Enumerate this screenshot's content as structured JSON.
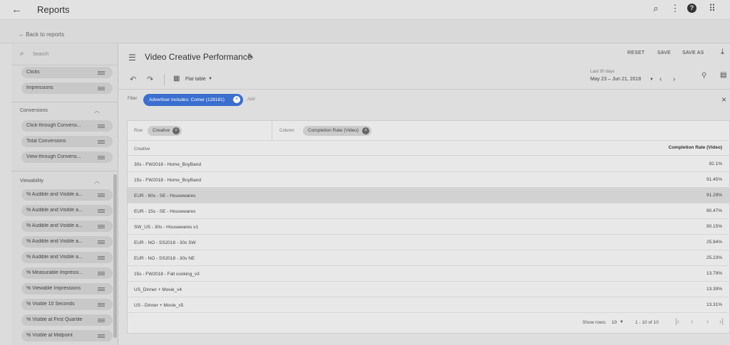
{
  "topbar": {
    "title": "Reports",
    "icons": [
      "back-arrow-icon",
      "search-icon",
      "more-vert-icon",
      "help-icon",
      "apps-icon"
    ]
  },
  "subbar": {
    "back_link": "← Back to reports"
  },
  "sidebar": {
    "search_placeholder": "Search",
    "metrics_top": [
      "Clicks",
      "Impressions"
    ],
    "sections": [
      {
        "title": "Conversions",
        "items": [
          "Click-through Conversi...",
          "Total Conversions",
          "View-through Conversi..."
        ]
      },
      {
        "title": "Viewability",
        "items": [
          "% Audible and Visible a...",
          "% Audible and Visible a...",
          "% Audible and Visible a...",
          "% Audible and Visible a...",
          "% Audible and Visible a...",
          "% Measurable Impressi...",
          "% Viewable Impressions",
          "% Visible 10 Seconds",
          "% Visible at First Quartile",
          "% Visible at Midpoint"
        ]
      }
    ]
  },
  "report": {
    "title": "Video Creative Performance",
    "actions": {
      "reset": "RESET",
      "save": "SAVE",
      "save_as": "SAVE AS"
    },
    "view_mode": "Flat table",
    "date_range": {
      "label": "Last 30 days",
      "value": "May 23 – Jun 21, 2018"
    },
    "filter": {
      "label": "Filter",
      "chip": "Advertiser includes: Comer (128181)",
      "add": "Add"
    },
    "row": {
      "label": "Row",
      "chip": "Creative"
    },
    "column": {
      "label": "Column",
      "chip": "Completion Rate (Video)"
    },
    "table": {
      "headers": [
        "Creative",
        "Completion Rate (Video)"
      ],
      "rows": [
        {
          "creative": "30s - FW2018 - Home_BoyBand",
          "value": "92.1%"
        },
        {
          "creative": "15s - FW2018 - Home_BoyBand",
          "value": "91.45%"
        },
        {
          "creative": "EUR - 60s - SE - Housewares",
          "value": "91.29%"
        },
        {
          "creative": "EUR - 15s - SE - Housewares",
          "value": "90.47%"
        },
        {
          "creative": "SW_US - 30s - Housewares v1",
          "value": "90.15%"
        },
        {
          "creative": "EUR - NO - SS2018 - 30s SW",
          "value": "25.94%"
        },
        {
          "creative": "EUR - NO - SS2018 - 30s NE",
          "value": "25.23%"
        },
        {
          "creative": "15s - FW2018 - Fall cooking_v3",
          "value": "13.79%"
        },
        {
          "creative": "US_Dinner + Movie_v4",
          "value": "13.39%"
        },
        {
          "creative": "US - Dinner + Movie_v5",
          "value": "13.31%"
        }
      ],
      "highlighted_row": 2
    },
    "pagination": {
      "show_rows_label": "Show rows:",
      "show_rows_value": "10",
      "range": "1 - 10 of 10"
    }
  }
}
